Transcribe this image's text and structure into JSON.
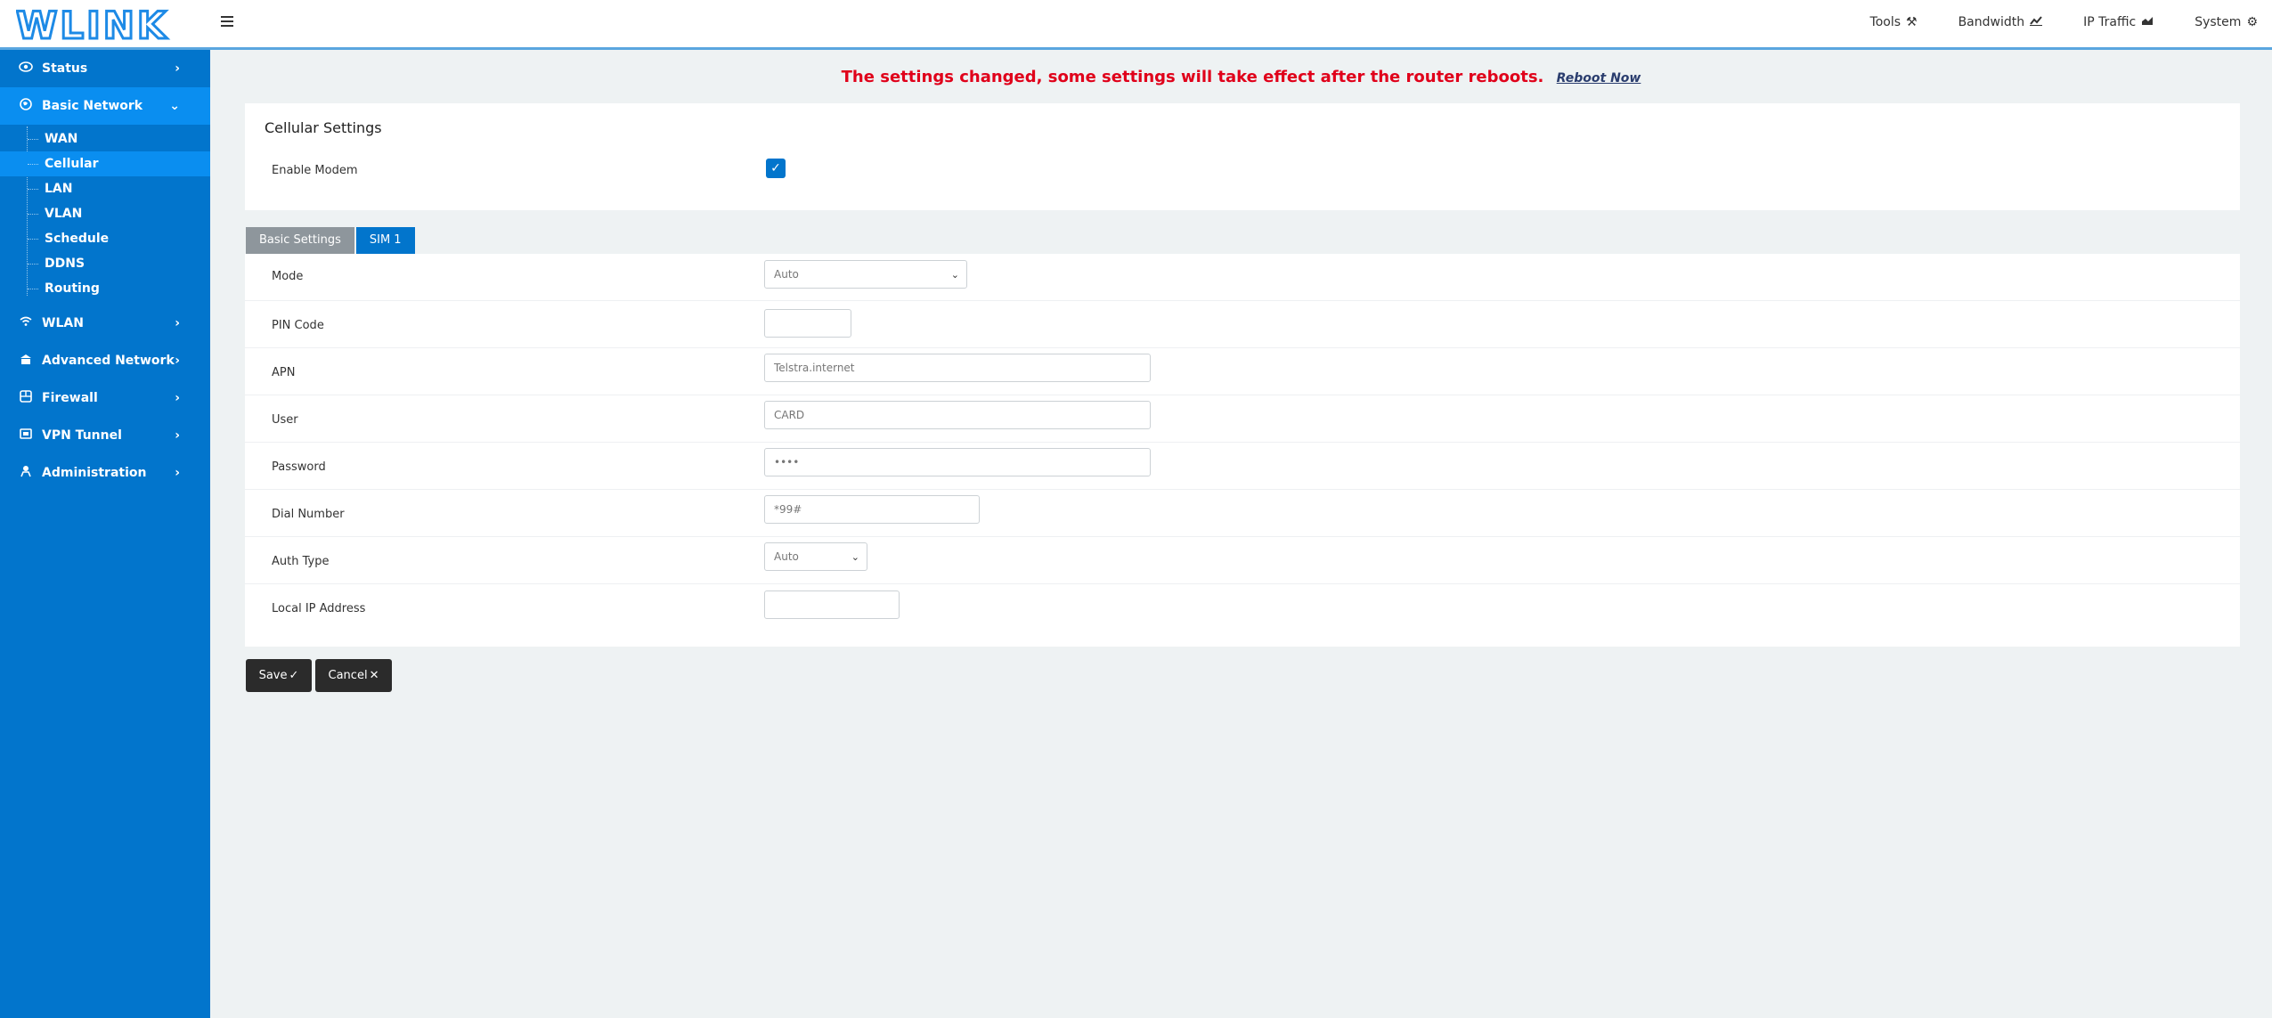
{
  "brand": {
    "logo_text": "WLINK"
  },
  "top_nav": [
    {
      "label": "Tools",
      "icon": "tools-icon",
      "glyph": "⚒"
    },
    {
      "label": "Bandwidth",
      "icon": "chart-line-icon",
      "glyph": "📈"
    },
    {
      "label": "IP Traffic",
      "icon": "chart-area-icon",
      "glyph": "▟"
    },
    {
      "label": "System",
      "icon": "gear-icon",
      "glyph": "⚙"
    }
  ],
  "sidebar": {
    "status": "Status",
    "basic_network": "Basic Network",
    "sub_items": [
      "WAN",
      "Cellular",
      "LAN",
      "VLAN",
      "Schedule",
      "DDNS",
      "Routing"
    ],
    "wlan": "WLAN",
    "advanced_network": "Advanced Network",
    "firewall": "Firewall",
    "vpn_tunnel": "VPN Tunnel",
    "administration": "Administration"
  },
  "notice": {
    "message": "The settings changed, some settings will take effect after the router reboots.",
    "reboot_link": "Reboot Now"
  },
  "cellular": {
    "title": "Cellular Settings",
    "enable_modem_label": "Enable Modem",
    "enable_modem_checked": true
  },
  "tabs": [
    "Basic Settings",
    "SIM 1"
  ],
  "form": {
    "mode_label": "Mode",
    "mode_value": "Auto",
    "pin_label": "PIN Code",
    "pin_value": "",
    "apn_label": "APN",
    "apn_value": "Telstra.internet",
    "user_label": "User",
    "user_value": "CARD",
    "password_label": "Password",
    "password_value": "••••",
    "dial_label": "Dial Number",
    "dial_value": "*99#",
    "auth_label": "Auth Type",
    "auth_value": "Auto",
    "local_ip_label": "Local IP Address",
    "local_ip_value": ""
  },
  "buttons": {
    "save": "Save",
    "save_glyph": "✓",
    "cancel": "Cancel",
    "cancel_glyph": "✕"
  },
  "colors": {
    "sidebar": "#0275cc",
    "active": "#0a8ef0",
    "notice": "#e0001a"
  }
}
